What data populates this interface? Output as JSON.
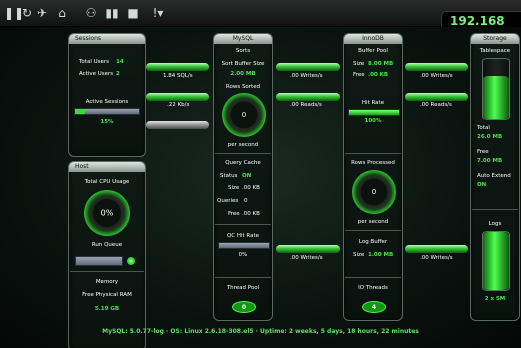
{
  "toolbar": {
    "icons": [
      "pause-icon",
      "refresh-icon",
      "tools-icon",
      "home-icon",
      "users-icon",
      "bar-chart-icon",
      "stop-icon",
      "alert-icon"
    ],
    "ip": "192.168"
  },
  "sessions": {
    "title": "Sessions",
    "total_users_label": "Total Users",
    "total_users": "14",
    "active_users_label": "Active Users",
    "active_users": "2",
    "active_sessions_label": "Active Sessions",
    "active_sessions_pct": "15%",
    "active_sessions_fraction": 0.15
  },
  "host": {
    "title": "Host",
    "cpu_label": "Total CPU Usage",
    "cpu": "0%",
    "run_queue_label": "Run Queue",
    "memory_label": "Memory",
    "free_ram_label": "Free Physical RAM",
    "free_ram": "5.19 GB"
  },
  "mysql": {
    "title": "MySQL",
    "sorts_label": "Sorts",
    "sort_buffer_label": "Sort Buffer Size",
    "sort_buffer": "2.00 MB",
    "rows_sorted_label": "Rows Sorted",
    "rows_sorted": "0",
    "per_second": "per second",
    "query_cache_label": "Query Cache",
    "status_label": "Status",
    "status": "ON",
    "size_label": "Size",
    "size": ".00 KB",
    "queries_label": "Queries",
    "queries": "0",
    "free_label": "Free",
    "free": ".00 KB",
    "qc_hit_rate_label": "QC Hit Rate",
    "qc_hit_rate": "0%",
    "thread_pool_label": "Thread Pool",
    "thread_pool": "0"
  },
  "innodb": {
    "title": "InnoDB",
    "buffer_pool_label": "Buffer Pool",
    "size_label": "Size",
    "size": "8.00 MB",
    "free_label": "Free",
    "free": ".00 KB",
    "hit_rate_label": "Hit Rate",
    "hit_rate": "100%",
    "rows_processed_label": "Rows Processed",
    "rows_processed": "0",
    "per_second": "per second",
    "log_buffer_label": "Log Buffer",
    "log_size_label": "Size",
    "log_size": "1.00 MB",
    "io_threads_label": "IO Threads",
    "io_threads": "4"
  },
  "storage": {
    "title": "Storage",
    "tablespace_label": "Tablespace",
    "total_label": "Total",
    "total": "26.0 MB",
    "free_label": "Free",
    "free": "7.00 MB",
    "auto_extend_label": "Auto Extend",
    "auto_extend": "ON",
    "logs_label": "Logs",
    "logs": "2 x 5M"
  },
  "flows": {
    "sql": "1.84 SQL/s",
    "kb": ".22 Kb/s",
    "w1": ".00 Writes/s",
    "r1": ".00 Reads/s",
    "w2": ".00 Writes/s",
    "r2": ".00 Reads/s",
    "w3": ".00 Writes/s",
    "w4": ".00 Writes/s"
  },
  "status_bar": "MySQL: 5.0.77-log  ·  OS: Linux 2.6.18-308.el5  ·  Uptime: 2 weeks, 5 days, 18 hours, 22 minutes"
}
